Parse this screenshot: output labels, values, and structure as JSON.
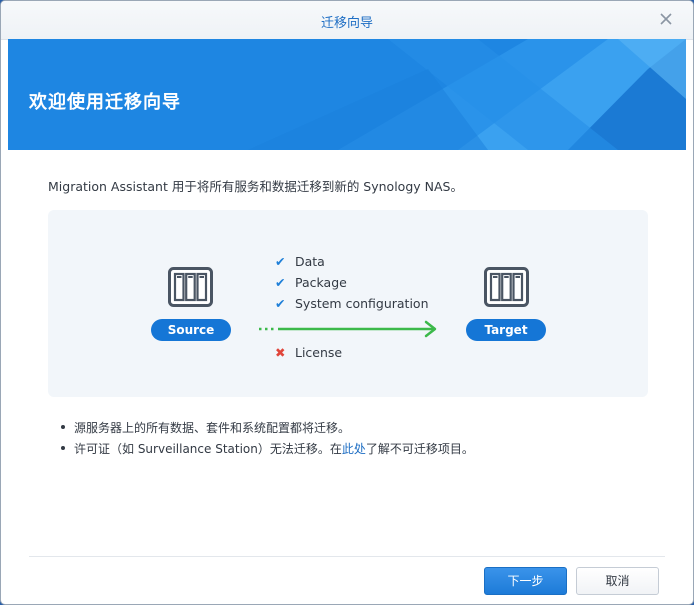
{
  "window": {
    "title": "迁移向导"
  },
  "hero": {
    "heading": "欢迎使用迁移向导"
  },
  "intro": {
    "text": "Migration Assistant 用于将所有服务和数据迁移到新的 Synology NAS。"
  },
  "diagram": {
    "source_label": "Source",
    "target_label": "Target",
    "migrated_items": [
      {
        "label": "Data",
        "icon": "check-icon"
      },
      {
        "label": "Package",
        "icon": "check-icon"
      },
      {
        "label": "System configuration",
        "icon": "check-icon"
      }
    ],
    "excluded_items": [
      {
        "label": "License",
        "icon": "x-icon"
      }
    ]
  },
  "notes": {
    "bullet1": "源服务器上的所有数据、套件和系统配置都将迁移。",
    "bullet2_prefix": "许可证（如 Surveillance Station）无法迁移。在",
    "bullet2_link": "此处",
    "bullet2_suffix": "了解不可迁移项目。"
  },
  "footer": {
    "next_label": "下一步",
    "cancel_label": "取消"
  },
  "colors": {
    "accent": "#1e6ec4",
    "hero_blue": "#1e86e2",
    "pill_blue": "#1576d6",
    "arrow_green": "#3cb94a",
    "check_blue": "#1e7fd8",
    "x_red": "#e0453a"
  }
}
